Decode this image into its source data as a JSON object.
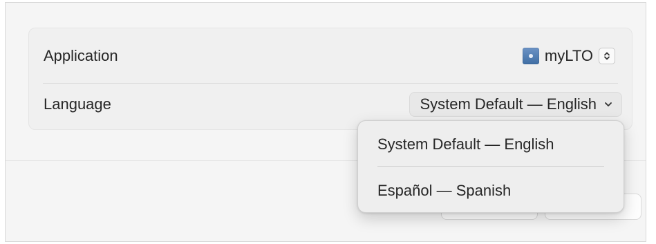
{
  "settings": {
    "application": {
      "label": "Application",
      "selected_app": "myLTO",
      "icon": "app-icon"
    },
    "language": {
      "label": "Language",
      "selected_value": "System Default — English",
      "icon": "chevron-down-icon"
    }
  },
  "dropdown": {
    "options": [
      {
        "label": "System Default — English"
      },
      {
        "label": "Español — Spanish"
      }
    ]
  },
  "colors": {
    "background": "#f5f5f5",
    "card": "#f0f0f0",
    "menu": "#eeeeee",
    "text": "#262626",
    "app_icon": "#4f7db5"
  }
}
